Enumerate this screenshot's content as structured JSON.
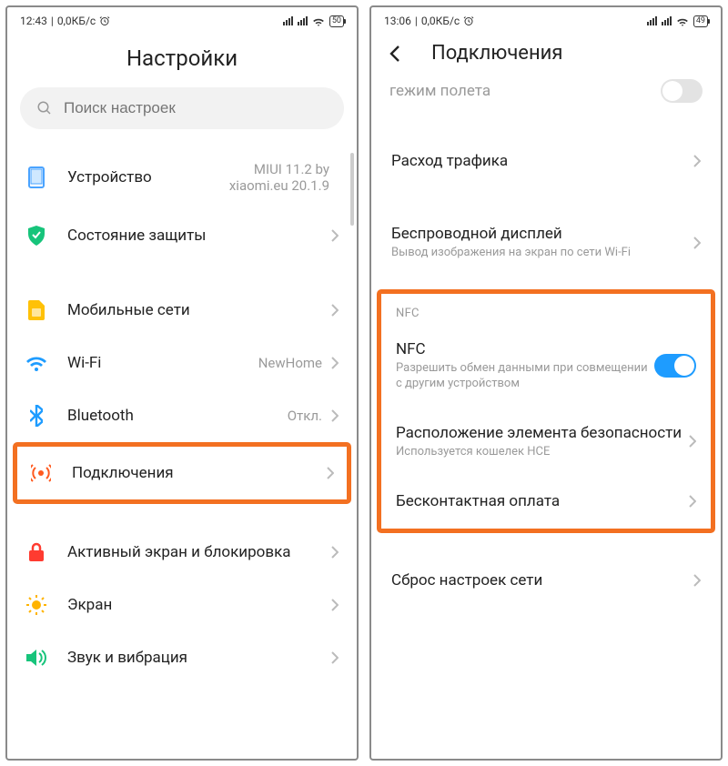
{
  "left": {
    "status": {
      "time": "12:43",
      "speed": "0,0КБ/с",
      "battery": "50"
    },
    "title": "Настройки",
    "search_placeholder": "Поиск настроек",
    "items": {
      "device": {
        "label": "Устройство",
        "value_l1": "MIUI 11.2 by",
        "value_l2": "xiaomi.eu 20.1.9"
      },
      "security": {
        "label": "Состояние защиты"
      },
      "mobile": {
        "label": "Мобильные сети"
      },
      "wifi": {
        "label": "Wi-Fi",
        "value": "NewHome"
      },
      "bt": {
        "label": "Bluetooth",
        "value": "Откл."
      },
      "conn": {
        "label": "Подключения"
      },
      "lock": {
        "label": "Активный экран и блокировка"
      },
      "display": {
        "label": "Экран"
      },
      "sound": {
        "label": "Звук и вибрация"
      }
    }
  },
  "right": {
    "status": {
      "time": "13:06",
      "speed": "0,0КБ/с",
      "battery": "49"
    },
    "title": "Подключения",
    "cutoff": "гежим полета",
    "items": {
      "traffic": {
        "label": "Расход трафика"
      },
      "wdisplay": {
        "label": "Беспроводной дисплей",
        "sub": "Вывод изображения на экран по сети Wi-Fi"
      },
      "nfc_head": "NFC",
      "nfc": {
        "label": "NFC",
        "sub": "Разрешить обмен данными при совмещении с другим устройством"
      },
      "secel": {
        "label": "Расположение элемента безопасности",
        "sub": "Используется кошелек HCE"
      },
      "pay": {
        "label": "Бесконтактная оплата"
      },
      "reset": {
        "label": "Сброс настроек сети"
      }
    }
  }
}
